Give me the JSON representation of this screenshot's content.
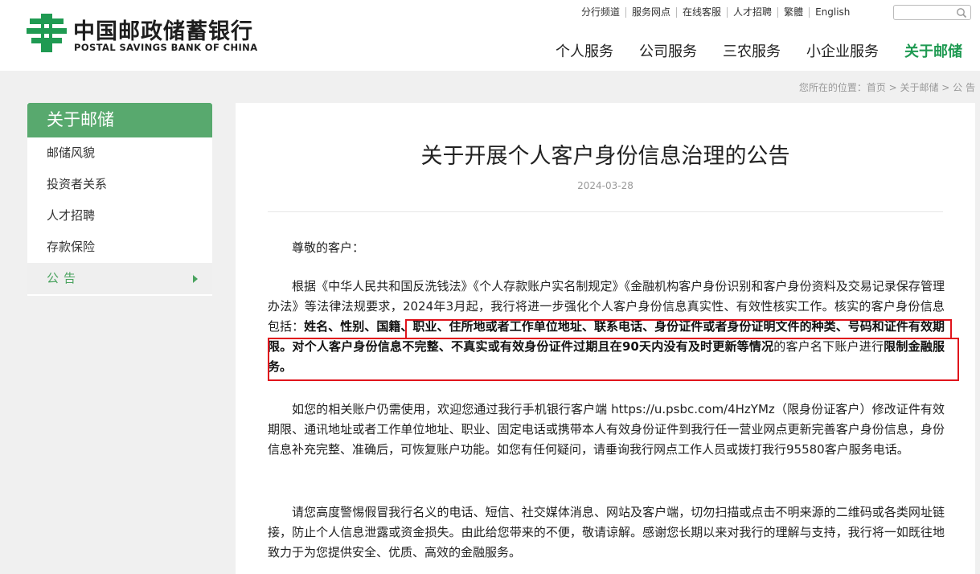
{
  "brand": {
    "name_cn": "中国邮政储蓄银行",
    "name_en": "POSTAL SAVINGS BANK OF CHINA",
    "color": "#1f9a52"
  },
  "top_links": [
    "分行频道",
    "服务网点",
    "在线客服",
    "人才招聘",
    "繁體",
    "English"
  ],
  "search": {
    "placeholder": "",
    "icon": "search-icon"
  },
  "main_nav": [
    {
      "label": "个人服务",
      "active": false
    },
    {
      "label": "公司服务",
      "active": false
    },
    {
      "label": "三农服务",
      "active": false
    },
    {
      "label": "小企业服务",
      "active": false
    },
    {
      "label": "关于邮储",
      "active": true
    }
  ],
  "breadcrumb": "您所在的位置：首页 > 关于邮储 > 公 告",
  "sidebar": {
    "title": "关于邮储",
    "items": [
      {
        "label": "邮储风貌",
        "active": false
      },
      {
        "label": "投资者关系",
        "active": false
      },
      {
        "label": "人才招聘",
        "active": false
      },
      {
        "label": "存款保险",
        "active": false
      },
      {
        "label": "公告",
        "active": true
      }
    ]
  },
  "article": {
    "title": "关于开展个人客户身份信息治理的公告",
    "date": "2024-03-28",
    "greeting": "尊敬的客户：",
    "p1_a": "根据《中华人民共和国反洗钱法》《个人存款账户实名制规定》《金融机构客户身份识别和客户身份资料及交易记录保存管理办法》等法律法规要求，2024年3月起，我行将进一步强化个人客户身份信息真实性、有效性核实工作。核实的客户身份信息包括：",
    "p1_bold": "姓名、性别、国籍、职业、住所地或者工作单位地址、联系电话、身份证件或者身份证明文件的种类、号码和证件有效期限。对个人客户身份信息不完整、不真实或有效身份证件过期且在90天内没有及时更新等情况",
    "p1_c": "的客户名下账户进行",
    "p1_bold2": "限制金融服务。",
    "p2": "如您的相关账户仍需使用，欢迎您通过我行手机银行客户端 https://u.psbc.com/4HzYMz（限身份证客户）修改证件有效期限、通讯地址或者工作单位地址、职业、固定电话或携带本人有效身份证件到我行任一营业网点更新完善客户身份信息，身份信息补充完整、准确后，可恢复账户功能。如您有任何疑问，请垂询我行网点工作人员或拨打我行95580客户服务电话。",
    "p3": "请您高度警惕假冒我行名义的电话、短信、社交媒体消息、网站及客户端，切勿扫描或点击不明来源的二维码或各类网址链接，防止个人信息泄露或资金损失。由此给您带来的不便，敬请谅解。感谢您长期以来对我行的理解与支持，我行将一如既往地致力于为您提供安全、优质、高效的金融服务。"
  },
  "highlight_color": "#e0141c"
}
